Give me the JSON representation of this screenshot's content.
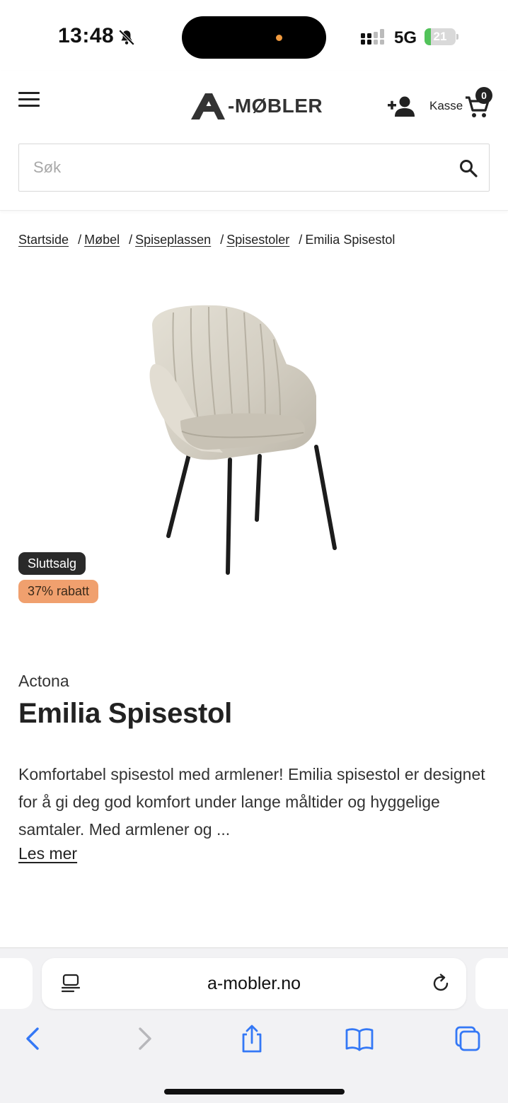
{
  "status_bar": {
    "time": "13:48",
    "network": "5G",
    "battery_level": "21",
    "battery_fraction": 0.21,
    "battery_color": "#52c35a",
    "island_dot_color": "#f09a3e"
  },
  "header": {
    "logo_text": "-MØBLER",
    "cart_label": "Kasse",
    "cart_count": "0",
    "search_placeholder": "Søk"
  },
  "breadcrumb": {
    "items": [
      "Startside",
      "Møbel",
      "Spiseplassen",
      "Spisestoler"
    ],
    "separator": "/",
    "current": "Emilia Spisestol"
  },
  "product": {
    "badges": {
      "sale": "Sluttsalg",
      "discount": "37% rabatt",
      "discount_color": "#f0a06e"
    },
    "brand": "Actona",
    "title": "Emilia Spisestol",
    "description": "Komfortabel spisestol med armlener! Emilia spisestol er designet for å gi deg god komfort under lange måltider og hyggelige samtaler. Med armlener og ...",
    "read_more": "Les mer"
  },
  "browser": {
    "url": "a-mobler.no",
    "accent_color": "#3478f6"
  }
}
